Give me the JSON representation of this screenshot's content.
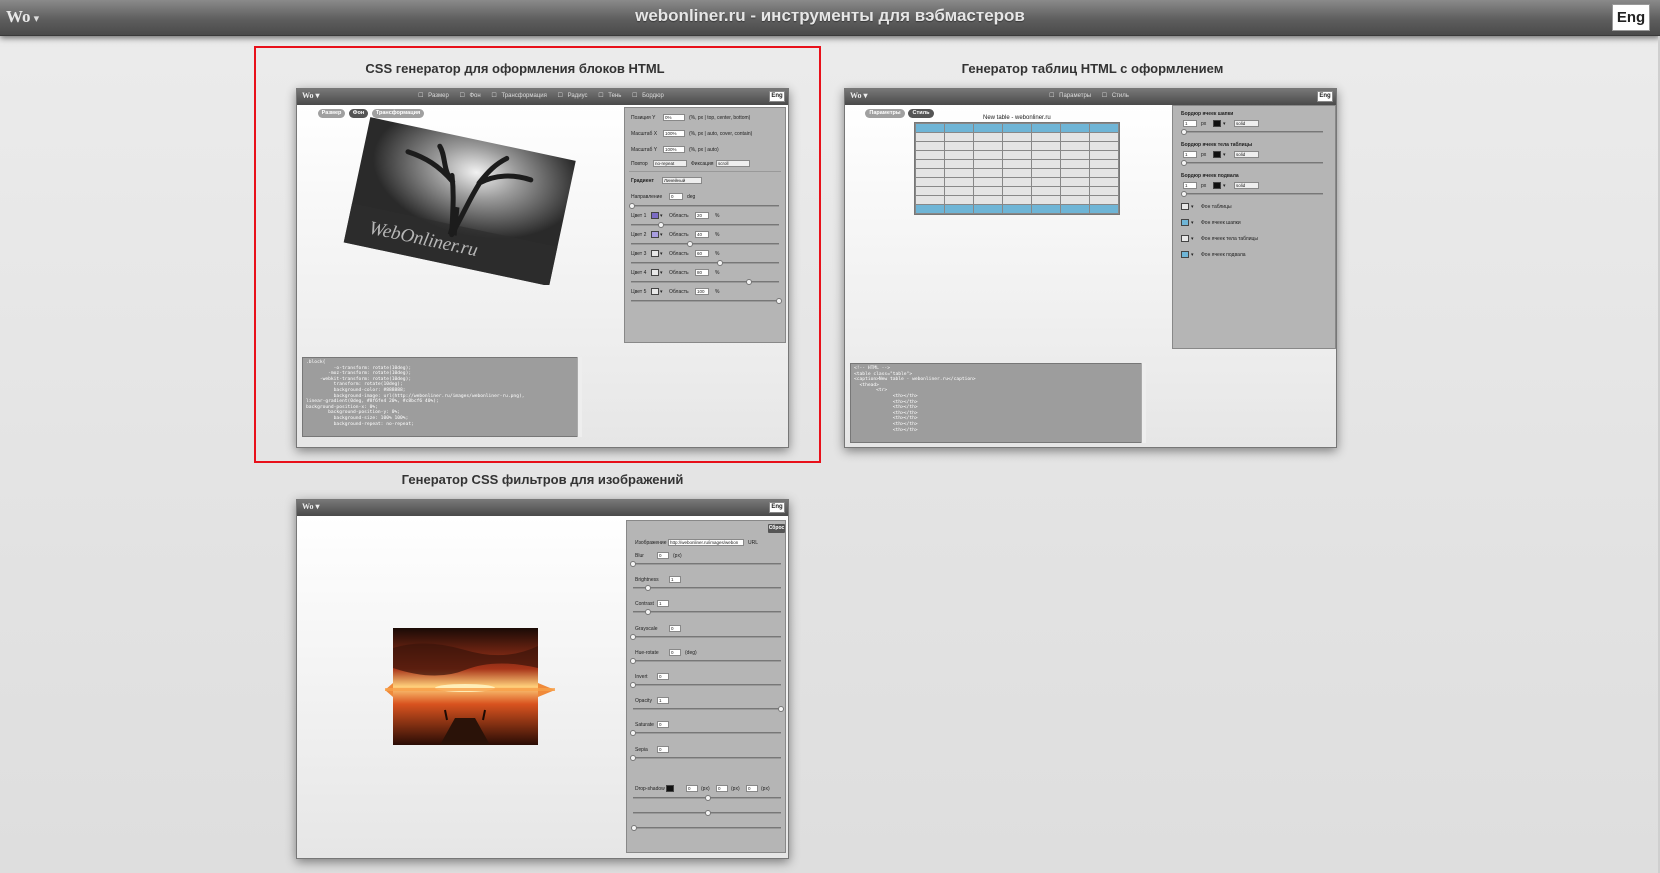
{
  "header": {
    "logo": "Wo",
    "logo_arrow": "▾",
    "title": "webonliner.ru - инструменты для вэбмастеров",
    "lang_button": "Eng"
  },
  "cards": [
    {
      "title": "CSS генератор для оформления блоков HTML",
      "selected": true,
      "mini": {
        "logo": "Wo ▾",
        "lang": "Eng",
        "nav": [
          "Размер",
          "Фон",
          "Трансформация",
          "Радиус",
          "Тень",
          "Бордюр"
        ],
        "tabs": [
          "Размер",
          "Фон",
          "Трансформация"
        ],
        "image_text": "WebOnliner.ru",
        "fields": [
          {
            "label": "Позиция Y",
            "value": "0%",
            "hint": "(%, px | top, center, bottom)"
          },
          {
            "label": "Масштаб X",
            "value": "100%",
            "hint": "(%, px | auto, cover, contain)"
          },
          {
            "label": "Масштаб Y",
            "value": "100%",
            "hint": "(%, px | auto)"
          }
        ],
        "repeat_label": "Повтор",
        "repeat_value": "no-repeat",
        "fixation_label": "Фиксация",
        "fixation_value": "scroll",
        "gradient_label": "Градиент",
        "gradient_value": "Линейный",
        "direction_label": "Направление",
        "direction_value": "0",
        "direction_unit": "deg",
        "colors": [
          {
            "label": "Цвет 1",
            "area_label": "Область",
            "area": "20",
            "unit": "%",
            "color": "#7b6bc4"
          },
          {
            "label": "Цвет 2",
            "area_label": "Область",
            "area": "40",
            "unit": "%",
            "color": "#a99ee0"
          },
          {
            "label": "Цвет 3",
            "area_label": "Область",
            "area": "60",
            "unit": "%",
            "color": "#e8e8e8"
          },
          {
            "label": "Цвет 4",
            "area_label": "Область",
            "area": "80",
            "unit": "%",
            "color": "#e8e8e8"
          },
          {
            "label": "Цвет 5",
            "area_label": "Область",
            "area": "100",
            "unit": "%",
            "color": "#e8e8e8"
          }
        ],
        "code": ".block{\n          -o-transform: rotate(10deg);\n        -moz-transform: rotate(10deg);\n     -webkit-transform: rotate(10deg);\n          transform: rotate(10deg);\n          background-color: #888888;\n          background-image: url(http://webonliner.ru/images/webonliner-ru.png),\nlinear-gradient(0deg, #8f6fe4 20%, #c8bcf6 40%);\nbackground-position-x: 0%;\n        background-position-y: 0%;\n          background-size: 100% 100%;\n          background-repeat: no-repeat;"
      }
    },
    {
      "title": "Генератор таблиц HTML с оформлением",
      "selected": false,
      "mini": {
        "logo": "Wo ▾",
        "lang": "Eng",
        "nav": [
          "Параметры",
          "Стиль"
        ],
        "tabs": [
          "Параметры",
          "Стиль"
        ],
        "table_caption": "New table - webonliner.ru",
        "border_sections": [
          {
            "label": "Бордюр ячеек шапки",
            "width": "1",
            "unit": "px",
            "style": "solid"
          },
          {
            "label": "Бордюр ячеек тела таблицы",
            "width": "1",
            "unit": "px",
            "style": "solid"
          },
          {
            "label": "Бордюр ячеек подвала",
            "width": "1",
            "unit": "px",
            "style": "solid"
          }
        ],
        "bg_options": [
          "Фон таблицы",
          "Фон ячеек шапки",
          "Фон ячеек тела таблицы",
          "Фон ячеек подвала"
        ],
        "code": "<!-- HTML -->\n<table class=\"table\">\n<caption>New table - webonliner.ru</caption>\n  <thead>\n        <tr>\n              <th></th>\n              <th></th>\n              <th></th>\n              <th></th>\n              <th></th>\n              <th></th>\n              <th></th>"
      }
    },
    {
      "title": "Генератор CSS фильтров для изображений",
      "selected": false,
      "mini": {
        "logo": "Wo ▾",
        "lang": "Eng",
        "reset_button": "Сброс",
        "image_label": "Изображение",
        "image_value": "http://webonliner.ru/images/webon",
        "image_unit": "URL",
        "filters": [
          {
            "label": "Blur",
            "value": "0",
            "unit": "(px)",
            "level": 0
          },
          {
            "label": "Brightness",
            "value": "1",
            "unit": "",
            "level": 0.1
          },
          {
            "label": "Contrast",
            "value": "1",
            "unit": "",
            "level": 0.1
          },
          {
            "label": "Grayscale",
            "value": "0",
            "unit": "",
            "level": 0
          },
          {
            "label": "Hue-rotate",
            "value": "0",
            "unit": "(deg)",
            "level": 0
          },
          {
            "label": "Invert",
            "value": "0",
            "unit": "",
            "level": 0
          },
          {
            "label": "Opacity",
            "value": "1",
            "unit": "",
            "level": 1
          },
          {
            "label": "Saturate",
            "value": "0",
            "unit": "",
            "level": 0
          },
          {
            "label": "Sepia",
            "value": "0",
            "unit": "",
            "level": 0
          }
        ],
        "drop_shadow_label": "Drop-shadow",
        "drop_shadow_values": [
          "0",
          "0",
          "0"
        ],
        "drop_shadow_unit": "(px)"
      }
    }
  ]
}
